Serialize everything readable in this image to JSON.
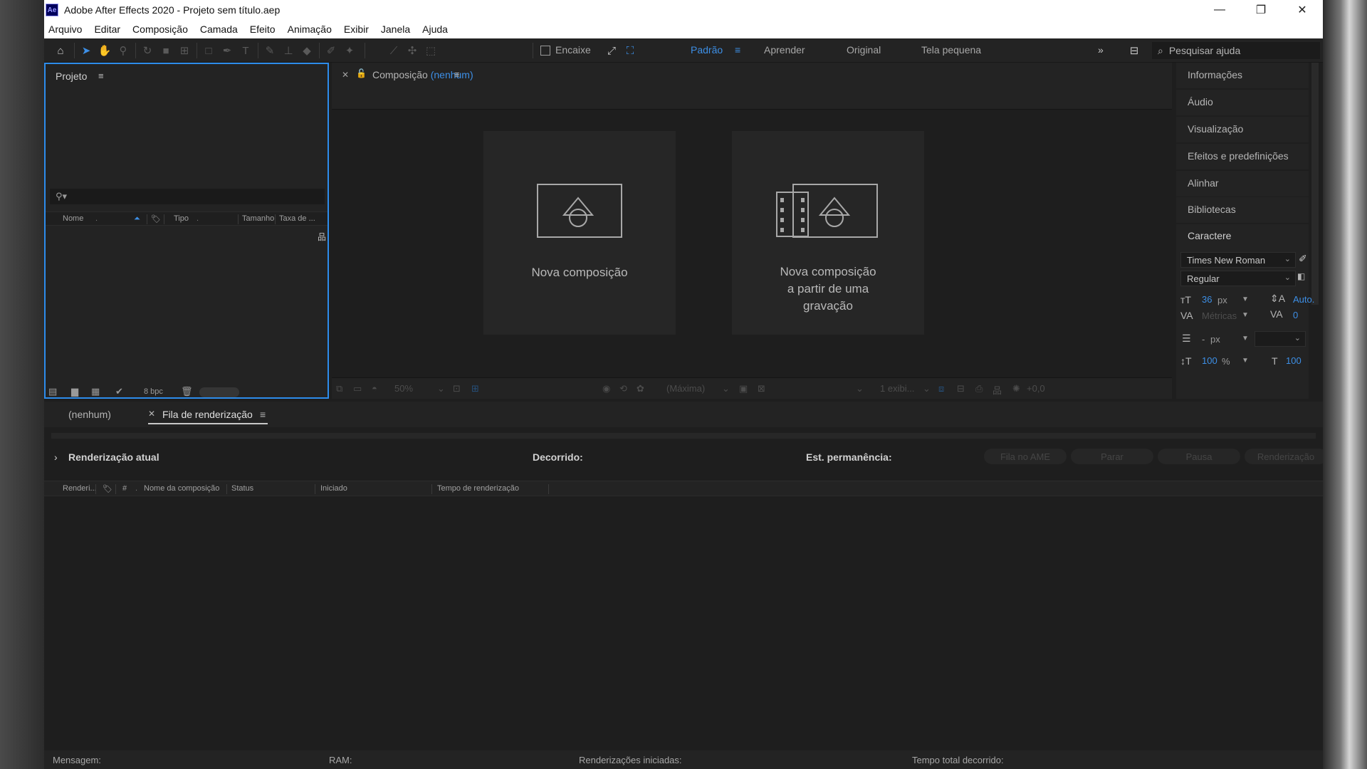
{
  "window": {
    "app_icon": "Ae",
    "title": "Adobe After Effects 2020 - Projeto sem título.aep",
    "controls": {
      "minimize": "—",
      "maximize": "❐",
      "close": "✕"
    }
  },
  "menu": [
    "Arquivo",
    "Editar",
    "Composição",
    "Camada",
    "Efeito",
    "Animação",
    "Exibir",
    "Janela",
    "Ajuda"
  ],
  "toolbar": {
    "snap_label": "Encaixe",
    "workspaces": [
      "Padrão",
      "Aprender",
      "Original",
      "Tela pequena"
    ],
    "active_workspace": "Padrão",
    "overflow": "»",
    "search_placeholder": "Pesquisar ajuda"
  },
  "project": {
    "title": "Projeto",
    "columns": [
      "Nome",
      "Tipo",
      "Tamanho",
      "Taxa de ..."
    ],
    "bpc": "8 bpc"
  },
  "composition": {
    "tab_label": "Composição",
    "tab_value": "(nenhum)",
    "card_new": "Nova composição",
    "card_footage": [
      "Nova composição",
      "a partir de uma",
      "gravação"
    ],
    "footer": {
      "zoom": "50%",
      "resolution": "(Máxima)",
      "views": "1 exibi...",
      "exposure": "+0,0"
    }
  },
  "right_panels": {
    "items": [
      "Informações",
      "Áudio",
      "Visualização",
      "Efeitos e predefinições",
      "Alinhar",
      "Bibliotecas"
    ],
    "character": {
      "title": "Caractere",
      "font": "Times New Roman",
      "style": "Regular",
      "size_value": "36",
      "size_unit": "px",
      "leading": "Auto.",
      "kerning": "Métricas",
      "tracking": "0",
      "stroke_value": "-",
      "stroke_unit": "px",
      "vscale": "100",
      "hscale": "100",
      "pct": "%"
    }
  },
  "render": {
    "tab_none": "(nenhum)",
    "tab_queue": "Fila de renderização",
    "current": "Renderização atual",
    "elapsed": "Decorrido:",
    "remaining": "Est. permanência:",
    "buttons": [
      "Fila no AME",
      "Parar",
      "Pausa",
      "Renderização"
    ],
    "columns": [
      "Renderi...",
      "#",
      "Nome da composição",
      "Status",
      "Iniciado",
      "Tempo de renderização"
    ],
    "footer": {
      "message": "Mensagem:",
      "ram": "RAM:",
      "started": "Renderizações iniciadas:",
      "total": "Tempo total decorrido:"
    }
  }
}
